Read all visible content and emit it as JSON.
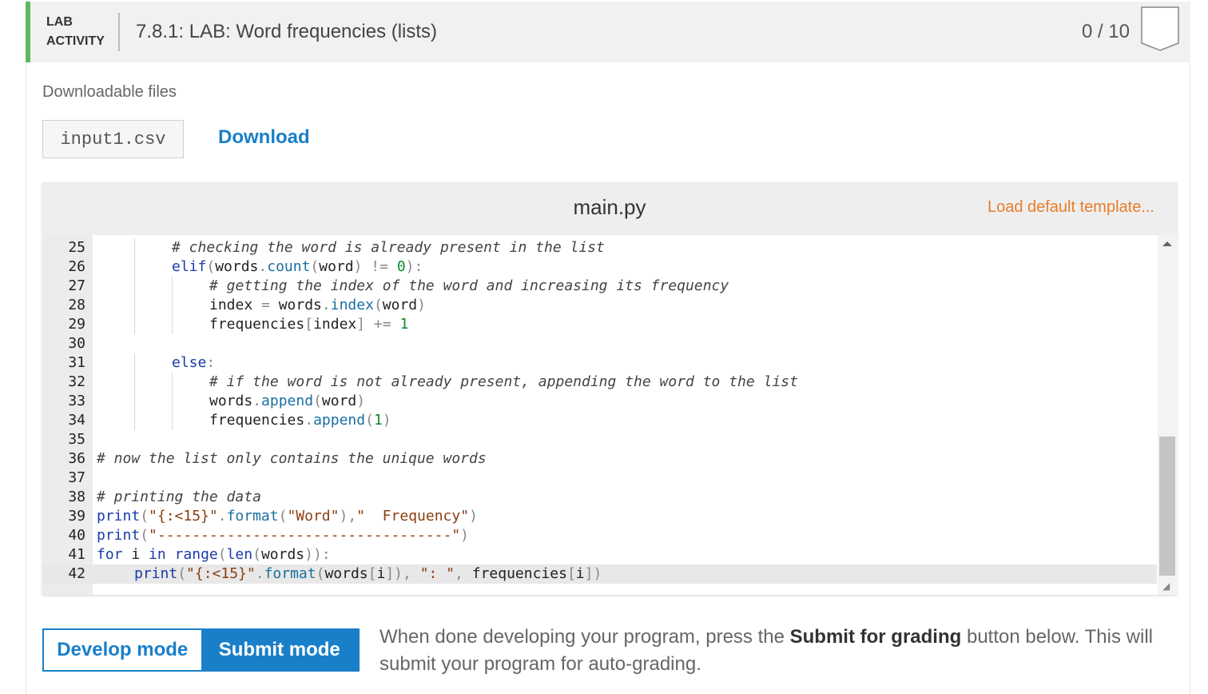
{
  "header": {
    "tag_line1": "LAB",
    "tag_line2": "ACTIVITY",
    "title": "7.8.1: LAB: Word frequencies (lists)",
    "score": "0 / 10"
  },
  "downloads": {
    "label": "Downloadable files",
    "file_name": "input1.csv",
    "download_label": "Download"
  },
  "editor": {
    "file_name": "main.py",
    "load_template_label": "Load default template...",
    "active_line": 42,
    "lines": [
      {
        "n": "25",
        "indent": 2,
        "html": "<span class=\"cm\"># checking the word is already present in the list</span>"
      },
      {
        "n": "26",
        "indent": 2,
        "html": "<span class=\"kw\">elif</span><span class=\"op\">(</span>words<span class=\"op\">.</span><span class=\"attr\">count</span><span class=\"op\">(</span>word<span class=\"op\">) != </span><span class=\"num\">0</span><span class=\"op\">):</span>"
      },
      {
        "n": "27",
        "indent": 3,
        "html": "<span class=\"cm\"># getting the index of the word and increasing its frequency</span>"
      },
      {
        "n": "28",
        "indent": 3,
        "html": "index <span class=\"op\">=</span> words<span class=\"op\">.</span><span class=\"attr\">index</span><span class=\"op\">(</span>word<span class=\"op\">)</span>"
      },
      {
        "n": "29",
        "indent": 3,
        "html": "frequencies<span class=\"op\">[</span>index<span class=\"op\">] +=</span> <span class=\"num\">1</span>"
      },
      {
        "n": "30",
        "indent": 0,
        "html": ""
      },
      {
        "n": "31",
        "indent": 2,
        "html": "<span class=\"kw\">else</span><span class=\"op\">:</span>"
      },
      {
        "n": "32",
        "indent": 3,
        "html": "<span class=\"cm\"># if the word is not already present, appending the word to the list</span>"
      },
      {
        "n": "33",
        "indent": 3,
        "html": "words<span class=\"op\">.</span><span class=\"attr\">append</span><span class=\"op\">(</span>word<span class=\"op\">)</span>"
      },
      {
        "n": "34",
        "indent": 3,
        "html": "frequencies<span class=\"op\">.</span><span class=\"attr\">append</span><span class=\"op\">(</span><span class=\"num\">1</span><span class=\"op\">)</span>"
      },
      {
        "n": "35",
        "indent": 0,
        "html": ""
      },
      {
        "n": "36",
        "indent": 0,
        "html": "<span class=\"cm\"># now the list only contains the unique words</span>"
      },
      {
        "n": "37",
        "indent": 0,
        "html": ""
      },
      {
        "n": "38",
        "indent": 0,
        "html": "<span class=\"cm\"># printing the data</span>"
      },
      {
        "n": "39",
        "indent": 0,
        "html": "<span class=\"fn\">print</span><span class=\"op\">(</span><span class=\"st\">\"{:&lt;15}\"</span><span class=\"op\">.</span><span class=\"attr\">format</span><span class=\"op\">(</span><span class=\"st\">\"Word\"</span><span class=\"op\">),</span><span class=\"st\">\"  Frequency\"</span><span class=\"op\">)</span>"
      },
      {
        "n": "40",
        "indent": 0,
        "html": "<span class=\"fn\">print</span><span class=\"op\">(</span><span class=\"st\">\"----------------------------------\"</span><span class=\"op\">)</span>"
      },
      {
        "n": "41",
        "indent": 0,
        "html": "<span class=\"kw\">for</span> i <span class=\"kw\">in</span> <span class=\"fn\">range</span><span class=\"op\">(</span><span class=\"fn\">len</span><span class=\"op\">(</span>words<span class=\"op\">)):</span>"
      },
      {
        "n": "42",
        "indent": 1,
        "html": "<span class=\"fn\">print</span><span class=\"op\">(</span><span class=\"st\">\"{:&lt;15}\"</span><span class=\"op\">.</span><span class=\"attr\">format</span><span class=\"op\">(</span>words<span class=\"op\">[</span>i<span class=\"op\">]),</span> <span class=\"st\">\": \"</span><span class=\"op\">,</span> frequencies<span class=\"op\">[</span>i<span class=\"op\">])</span>"
      }
    ]
  },
  "mode": {
    "develop_label": "Develop mode",
    "submit_label": "Submit mode",
    "help_prefix": "When done developing your program, press the ",
    "help_bold": "Submit for grading",
    "help_suffix": " button below. This will submit your program for auto-grading."
  }
}
